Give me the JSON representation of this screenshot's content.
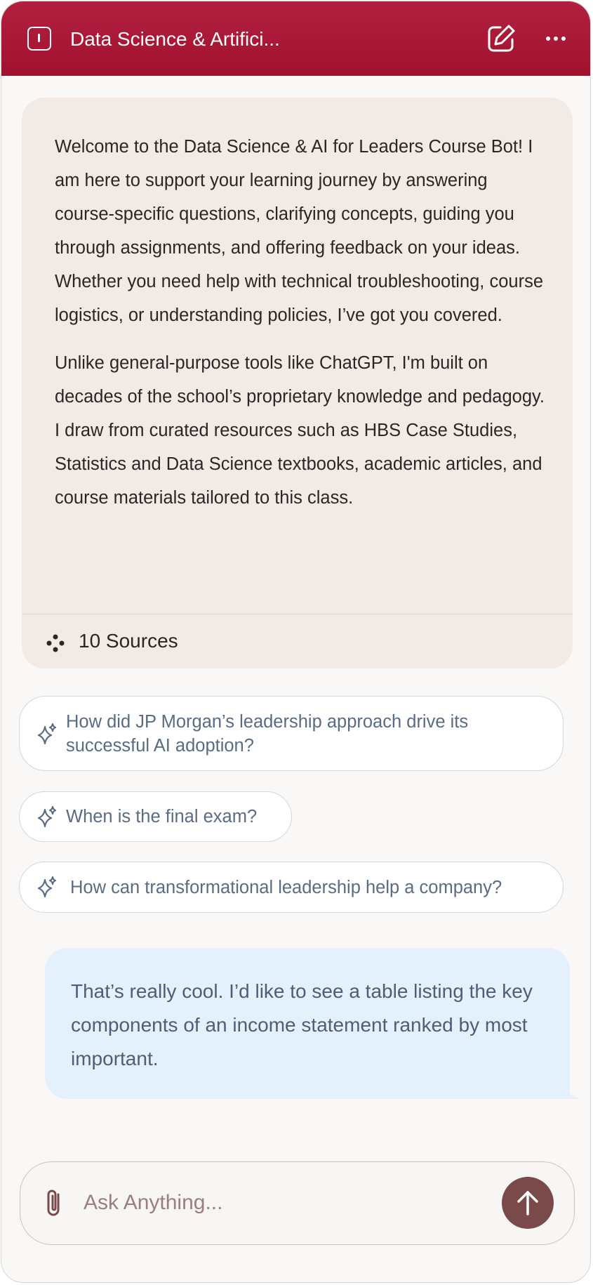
{
  "header": {
    "title": "Data Science & Artifici...",
    "icons": [
      "sidebar-toggle-icon",
      "new-chat-icon",
      "more-options-icon"
    ],
    "color": "#a7162f"
  },
  "bot_message": {
    "paragraphs": [
      "Welcome to the Data Science & AI for Leaders Course Bot! I am here to support your learning journey by answering course-specific questions, clarifying concepts, guiding you through assignments, and offering feedback on your ideas. Whether you need help with technical troubleshooting, course logistics, or understanding policies, I’ve got you covered.",
      "Unlike general-purpose tools like ChatGPT, I'm built on decades of the school’s proprietary knowledge and pedagogy. I draw from curated resources such as HBS Case Studies, Statistics and Data Science textbooks, academic articles, and course materials tailored to this class."
    ],
    "sources_label": "10 Sources",
    "sources_icon": "sources-icon",
    "background": "#f2ebe5"
  },
  "suggestions": [
    {
      "text": "How did JP Morgan’s leadership approach drive its successful AI adoption?",
      "icon": "sparkle-icon"
    },
    {
      "text": "When is the final exam?",
      "icon": "sparkle-icon"
    },
    {
      "text": "How can transformational leadership help a company?",
      "icon": "sparkle-icon"
    }
  ],
  "user_message": {
    "text": "That’s really cool. I’d like to see a table listing the key components of an income statement ranked by most important.",
    "background": "#e4f0fc"
  },
  "composer": {
    "placeholder": "Ask Anything...",
    "value": "",
    "attach_icon": "paperclip-icon",
    "send_icon": "arrow-up-icon",
    "send_color": "#7a4a4a"
  }
}
